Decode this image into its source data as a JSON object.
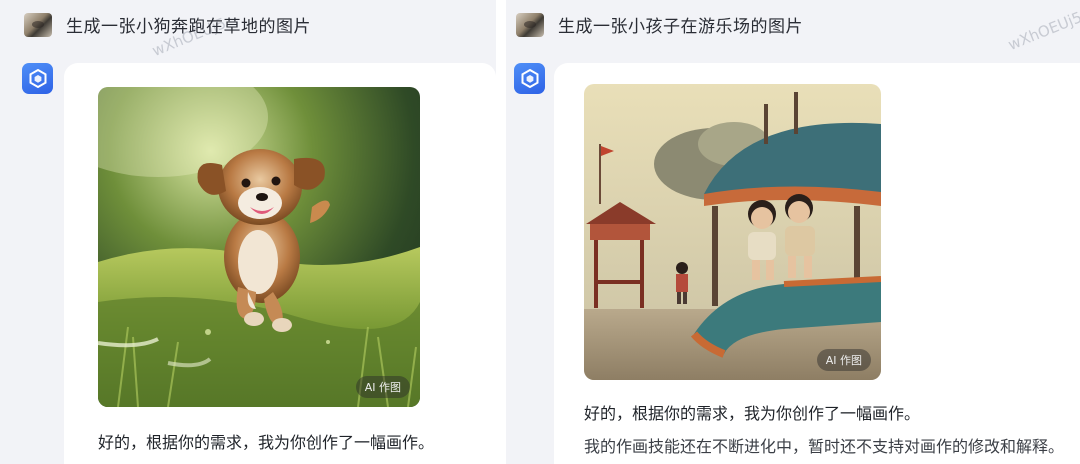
{
  "watermark": "wXhOEUj5",
  "image_badge": "AI 作图",
  "colors": {
    "accent": "#3a73f0",
    "panel_bg": "#f2f3f7",
    "card_bg": "#ffffff"
  },
  "left": {
    "prompt": "生成一张小狗奔跑在草地的图片",
    "image_alt": "puppy-running-on-grass",
    "reply": "好的，根据你的需求，我为你创作了一幅画作。"
  },
  "right": {
    "prompt": "生成一张小孩子在游乐场的图片",
    "image_alt": "children-at-playground",
    "reply": "好的，根据你的需求，我为你创作了一幅画作。",
    "reply2": "我的作画技能还在不断进化中，暂时还不支持对画作的修改和解释。"
  }
}
